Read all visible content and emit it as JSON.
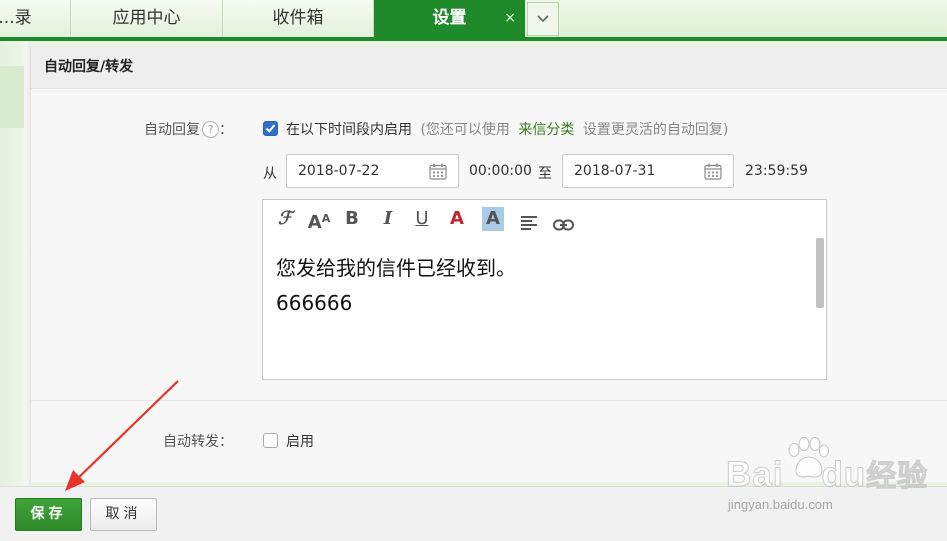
{
  "tabs": [
    {
      "label": "...录",
      "active": false
    },
    {
      "label": "应用中心",
      "active": false
    },
    {
      "label": "收件箱",
      "active": false
    },
    {
      "label": "设置",
      "active": true
    }
  ],
  "tab_close": "×",
  "panel": {
    "title": "自动回复/转发"
  },
  "auto_reply": {
    "label": "自动回复",
    "help": "?",
    "colon": "：",
    "checkbox_checked": true,
    "enable_text": "在以下时间段内启用",
    "hint_prefix": "(您还可以使用",
    "hint_link": "来信分类",
    "hint_suffix": "设置更灵活的自动回复)",
    "from_label": "从",
    "start_date": "2018-07-22",
    "start_time": "00:00:00",
    "to_label": "至",
    "end_date": "2018-07-31",
    "end_time": "23:59:59"
  },
  "editor": {
    "toolbar": [
      "font-family-icon",
      "font-size-icon",
      "bold-icon",
      "italic-icon",
      "underline-icon",
      "font-color-icon",
      "highlight-color-icon",
      "align-icon",
      "link-icon"
    ],
    "lines": [
      "您发给我的信件已经收到。",
      "666666"
    ]
  },
  "auto_forward": {
    "label": "自动转发：",
    "checkbox_checked": false,
    "enable_text": "启用"
  },
  "buttons": {
    "save": "保存",
    "cancel": "取消"
  },
  "watermark": {
    "brand": "Bai",
    "brand_tail": "du",
    "brand_cn": "经验",
    "url": "jingyan.baidu.com"
  },
  "colors": {
    "accent": "#1f8a2a",
    "link": "#3a7d22",
    "checkbox": "#2f6fc9",
    "arrow": "#e8322a"
  }
}
